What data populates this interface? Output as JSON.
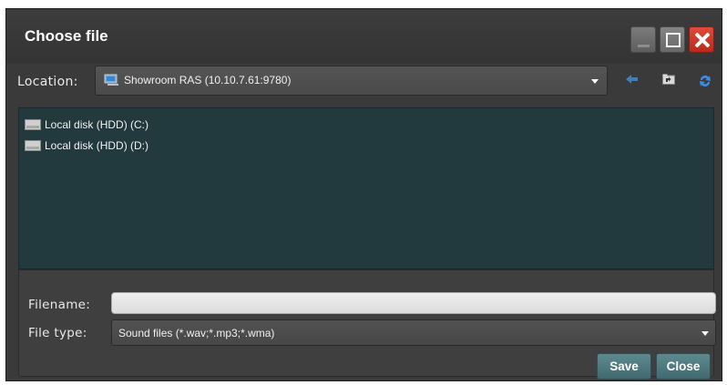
{
  "dialog": {
    "title": "Choose file",
    "window_buttons": [
      "minimize-icon",
      "maximize-icon",
      "close-icon"
    ]
  },
  "location": {
    "label": "Location:",
    "value": "Showroom RAS (10.10.7.61:9780)",
    "icon": "computer-icon",
    "tools": [
      "back-arrow-icon",
      "parent-folder-icon",
      "refresh-icon"
    ]
  },
  "files": [
    {
      "label": "Local disk (HDD) (C:)",
      "icon": "drive-icon"
    },
    {
      "label": "Local disk (HDD) (D:)",
      "icon": "drive-icon"
    }
  ],
  "filename": {
    "label": "Filename:",
    "value": ""
  },
  "filetype": {
    "label": "File type:",
    "value": "Sound files (*.wav;*.mp3;*.wma)"
  },
  "buttons": {
    "save": "Save",
    "close": "Close"
  },
  "colors": {
    "list_background": "#22393e",
    "button_accent": "#4f7b80",
    "window_close": "#d03a2a"
  }
}
